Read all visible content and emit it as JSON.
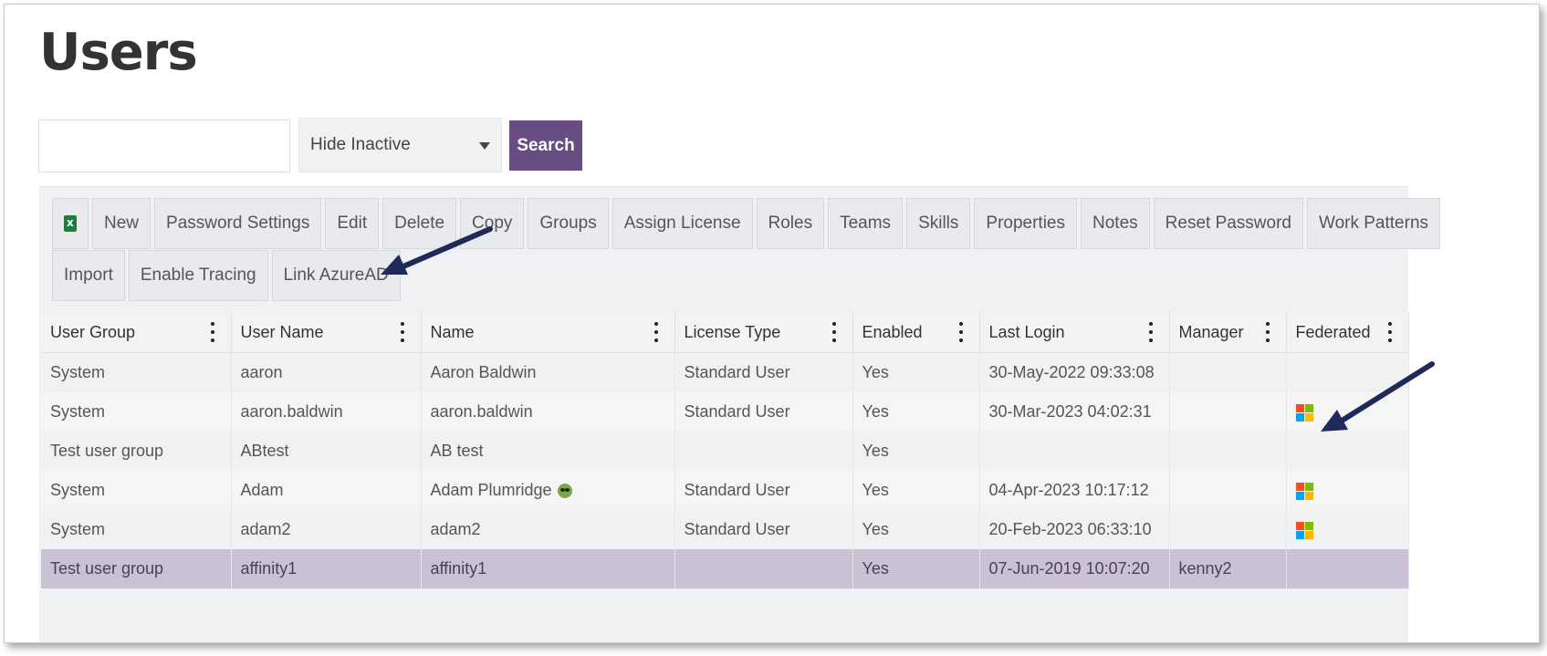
{
  "page": {
    "title": "Users"
  },
  "search": {
    "value": "",
    "placeholder": "",
    "filter_selected": "Hide Inactive",
    "button_label": "Search"
  },
  "toolbar": {
    "row1": [
      {
        "label": "",
        "icon": "excel-export-icon"
      },
      {
        "label": "New"
      },
      {
        "label": "Password Settings"
      },
      {
        "label": "Edit"
      },
      {
        "label": "Delete"
      },
      {
        "label": "Copy"
      },
      {
        "label": "Groups"
      },
      {
        "label": "Assign License"
      },
      {
        "label": "Roles"
      },
      {
        "label": "Teams"
      },
      {
        "label": "Skills"
      },
      {
        "label": "Properties"
      },
      {
        "label": "Notes"
      },
      {
        "label": "Reset Password"
      },
      {
        "label": "Work Patterns"
      }
    ],
    "row2": [
      {
        "label": "Import"
      },
      {
        "label": "Enable Tracing"
      },
      {
        "label": "Link AzureAD"
      }
    ]
  },
  "table": {
    "columns": [
      "User Group",
      "User Name",
      "Name",
      "License Type",
      "Enabled",
      "Last Login",
      "Manager",
      "Federated"
    ],
    "rows": [
      {
        "user_group": "System",
        "user_name": "aaron",
        "name": "Aaron Baldwin",
        "license_type": "Standard User",
        "enabled": "Yes",
        "last_login": "30-May-2022 09:33:08",
        "manager": "",
        "federated": false,
        "emoji": false,
        "selected": false
      },
      {
        "user_group": "System",
        "user_name": "aaron.baldwin",
        "name": "aaron.baldwin",
        "license_type": "Standard User",
        "enabled": "Yes",
        "last_login": "30-Mar-2023 04:02:31",
        "manager": "",
        "federated": true,
        "emoji": false,
        "selected": false
      },
      {
        "user_group": "Test user group",
        "user_name": "ABtest",
        "name": "AB test",
        "license_type": "",
        "enabled": "Yes",
        "last_login": "",
        "manager": "",
        "federated": false,
        "emoji": false,
        "selected": false
      },
      {
        "user_group": "System",
        "user_name": "Adam",
        "name": "Adam Plumridge",
        "license_type": "Standard User",
        "enabled": "Yes",
        "last_login": "04-Apr-2023 10:17:12",
        "manager": "",
        "federated": true,
        "emoji": true,
        "selected": false
      },
      {
        "user_group": "System",
        "user_name": "adam2",
        "name": "adam2",
        "license_type": "Standard User",
        "enabled": "Yes",
        "last_login": "20-Feb-2023 06:33:10",
        "manager": "",
        "federated": true,
        "emoji": false,
        "selected": false
      },
      {
        "user_group": "Test user group",
        "user_name": "affinity1",
        "name": "affinity1",
        "license_type": "",
        "enabled": "Yes",
        "last_login": "07-Jun-2019 10:07:20",
        "manager": "kenny2",
        "federated": false,
        "emoji": false,
        "selected": true
      }
    ]
  },
  "colors": {
    "accent": "#674d82",
    "selected_row": "#cbc1d4",
    "arrow": "#1f2a5a",
    "ms_red": "#f25022",
    "ms_green": "#7fba00",
    "ms_blue": "#00a4ef",
    "ms_yellow": "#ffb900"
  }
}
